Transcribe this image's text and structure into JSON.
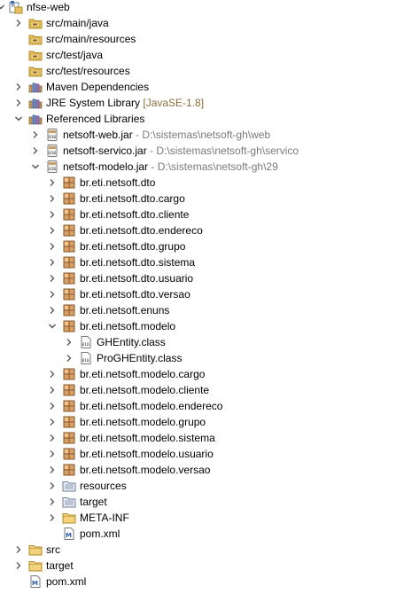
{
  "tree": [
    {
      "level": 0,
      "label": "nfse-web",
      "decor": "",
      "icon": "project",
      "toggle": "expanded",
      "name": "project-nfse-web"
    },
    {
      "level": 1,
      "label": "src/main/java",
      "decor": "",
      "icon": "srcfolder",
      "toggle": "collapsed",
      "name": "source-folder-src-main-java"
    },
    {
      "level": 1,
      "label": "src/main/resources",
      "decor": "",
      "icon": "srcfolder",
      "toggle": "none",
      "name": "source-folder-src-main-resources"
    },
    {
      "level": 1,
      "label": "src/test/java",
      "decor": "",
      "icon": "srcfolder",
      "toggle": "none",
      "name": "source-folder-src-test-java"
    },
    {
      "level": 1,
      "label": "src/test/resources",
      "decor": "",
      "icon": "srcfolder",
      "toggle": "none",
      "name": "source-folder-src-test-resources"
    },
    {
      "level": 1,
      "label": "Maven Dependencies",
      "decor": "",
      "icon": "library",
      "toggle": "collapsed",
      "name": "maven-dependencies"
    },
    {
      "level": 1,
      "label": "JRE System Library",
      "decor": "[JavaSE-1.8]",
      "icon": "library",
      "toggle": "collapsed",
      "name": "jre-system-library"
    },
    {
      "level": 1,
      "label": "Referenced Libraries",
      "decor": "",
      "icon": "library",
      "toggle": "expanded",
      "name": "referenced-libraries"
    },
    {
      "level": 2,
      "label": "netsoft-web.jar",
      "decor": "- D:\\sistemas\\netsoft-gh\\web",
      "icon": "jar",
      "toggle": "collapsed",
      "name": "jar-netsoft-web"
    },
    {
      "level": 2,
      "label": "netsoft-servico.jar",
      "decor": "- D:\\sistemas\\netsoft-gh\\servico",
      "icon": "jar",
      "toggle": "collapsed",
      "name": "jar-netsoft-servico"
    },
    {
      "level": 2,
      "label": "netsoft-modelo.jar",
      "decor": "- D:\\sistemas\\netsoft-gh\\29",
      "icon": "jar",
      "toggle": "expanded",
      "name": "jar-netsoft-modelo"
    },
    {
      "level": 3,
      "label": "br.eti.netsoft.dto",
      "decor": "",
      "icon": "package",
      "toggle": "collapsed",
      "name": "package-dto"
    },
    {
      "level": 3,
      "label": "br.eti.netsoft.dto.cargo",
      "decor": "",
      "icon": "package",
      "toggle": "collapsed",
      "name": "package-dto-cargo"
    },
    {
      "level": 3,
      "label": "br.eti.netsoft.dto.cliente",
      "decor": "",
      "icon": "package",
      "toggle": "collapsed",
      "name": "package-dto-cliente"
    },
    {
      "level": 3,
      "label": "br.eti.netsoft.dto.endereco",
      "decor": "",
      "icon": "package",
      "toggle": "collapsed",
      "name": "package-dto-endereco"
    },
    {
      "level": 3,
      "label": "br.eti.netsoft.dto.grupo",
      "decor": "",
      "icon": "package",
      "toggle": "collapsed",
      "name": "package-dto-grupo"
    },
    {
      "level": 3,
      "label": "br.eti.netsoft.dto.sistema",
      "decor": "",
      "icon": "package",
      "toggle": "collapsed",
      "name": "package-dto-sistema"
    },
    {
      "level": 3,
      "label": "br.eti.netsoft.dto.usuario",
      "decor": "",
      "icon": "package",
      "toggle": "collapsed",
      "name": "package-dto-usuario"
    },
    {
      "level": 3,
      "label": "br.eti.netsoft.dto.versao",
      "decor": "",
      "icon": "package",
      "toggle": "collapsed",
      "name": "package-dto-versao"
    },
    {
      "level": 3,
      "label": "br.eti.netsoft.enuns",
      "decor": "",
      "icon": "package",
      "toggle": "collapsed",
      "name": "package-enuns"
    },
    {
      "level": 3,
      "label": "br.eti.netsoft.modelo",
      "decor": "",
      "icon": "package",
      "toggle": "expanded",
      "name": "package-modelo"
    },
    {
      "level": 4,
      "label": "GHEntity.class",
      "decor": "",
      "icon": "classfile",
      "toggle": "collapsed",
      "name": "class-ghentity"
    },
    {
      "level": 4,
      "label": "ProGHEntity.class",
      "decor": "",
      "icon": "classfile",
      "toggle": "collapsed",
      "name": "class-proghentity"
    },
    {
      "level": 3,
      "label": "br.eti.netsoft.modelo.cargo",
      "decor": "",
      "icon": "package",
      "toggle": "collapsed",
      "name": "package-modelo-cargo"
    },
    {
      "level": 3,
      "label": "br.eti.netsoft.modelo.cliente",
      "decor": "",
      "icon": "package",
      "toggle": "collapsed",
      "name": "package-modelo-cliente"
    },
    {
      "level": 3,
      "label": "br.eti.netsoft.modelo.endereco",
      "decor": "",
      "icon": "package",
      "toggle": "collapsed",
      "name": "package-modelo-endereco"
    },
    {
      "level": 3,
      "label": "br.eti.netsoft.modelo.grupo",
      "decor": "",
      "icon": "package",
      "toggle": "collapsed",
      "name": "package-modelo-grupo"
    },
    {
      "level": 3,
      "label": "br.eti.netsoft.modelo.sistema",
      "decor": "",
      "icon": "package",
      "toggle": "collapsed",
      "name": "package-modelo-sistema"
    },
    {
      "level": 3,
      "label": "br.eti.netsoft.modelo.usuario",
      "decor": "",
      "icon": "package",
      "toggle": "collapsed",
      "name": "package-modelo-usuario"
    },
    {
      "level": 3,
      "label": "br.eti.netsoft.modelo.versao",
      "decor": "",
      "icon": "package",
      "toggle": "collapsed",
      "name": "package-modelo-versao"
    },
    {
      "level": 3,
      "label": "resources",
      "decor": "",
      "icon": "resfolder",
      "toggle": "collapsed",
      "name": "folder-resources"
    },
    {
      "level": 3,
      "label": "target",
      "decor": "",
      "icon": "resfolder",
      "toggle": "collapsed",
      "name": "folder-target-in-jar"
    },
    {
      "level": 3,
      "label": "META-INF",
      "decor": "",
      "icon": "folder",
      "toggle": "collapsed",
      "name": "folder-meta-inf"
    },
    {
      "level": 3,
      "label": "pom.xml",
      "decor": "",
      "icon": "maven",
      "toggle": "none",
      "name": "file-pom-in-jar"
    },
    {
      "level": 1,
      "label": "src",
      "decor": "",
      "icon": "folder",
      "toggle": "collapsed",
      "name": "folder-src"
    },
    {
      "level": 1,
      "label": "target",
      "decor": "",
      "icon": "folder",
      "toggle": "collapsed",
      "name": "folder-target"
    },
    {
      "level": 1,
      "label": "pom.xml",
      "decor": "",
      "icon": "maven",
      "toggle": "none",
      "name": "file-pom"
    }
  ],
  "icon_names": {
    "project": "project-icon",
    "srcfolder": "source-folder-icon",
    "library": "library-icon",
    "jar": "jar-icon",
    "package": "package-icon",
    "classfile": "class-file-icon",
    "folder": "folder-icon",
    "resfolder": "resource-folder-icon",
    "maven": "maven-file-icon"
  },
  "colors": {
    "decoration_gray": "#7a7a7a",
    "decoration_jre": "#8c6e3c",
    "folder_yellow": "#e8c25a",
    "package_brown": "#b07a3c"
  }
}
